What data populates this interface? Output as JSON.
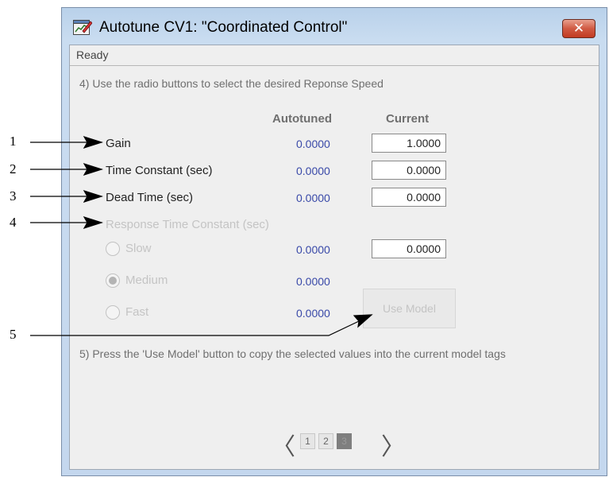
{
  "window": {
    "title": "Autotune CV1:  \"Coordinated Control\"",
    "close_label": "✕",
    "status": "Ready"
  },
  "instructions": {
    "step4": "4) Use the radio buttons to select the desired Reponse Speed",
    "step5": "5) Press the 'Use Model' button to copy the selected values into the current model tags"
  },
  "headers": {
    "autotuned": "Autotuned",
    "current": "Current"
  },
  "params": [
    {
      "label": "Gain",
      "autotuned": "0.0000",
      "current": "1.0000"
    },
    {
      "label": "Time Constant (sec)",
      "autotuned": "0.0000",
      "current": "0.0000"
    },
    {
      "label": "Dead Time (sec)",
      "autotuned": "0.0000",
      "current": "0.0000"
    }
  ],
  "response": {
    "label": "Response Time Constant (sec)",
    "options": [
      {
        "label": "Slow",
        "autotuned": "0.0000",
        "selected": false
      },
      {
        "label": "Medium",
        "autotuned": "0.0000",
        "selected": true
      },
      {
        "label": "Fast",
        "autotuned": "0.0000",
        "selected": false
      }
    ],
    "current": "0.0000"
  },
  "use_model_label": "Use Model",
  "pager": {
    "pages": [
      "1",
      "2",
      "3"
    ],
    "active": 3,
    "prev": "〈",
    "next": "〉"
  },
  "callouts": [
    "1",
    "2",
    "3",
    "4",
    "5"
  ]
}
